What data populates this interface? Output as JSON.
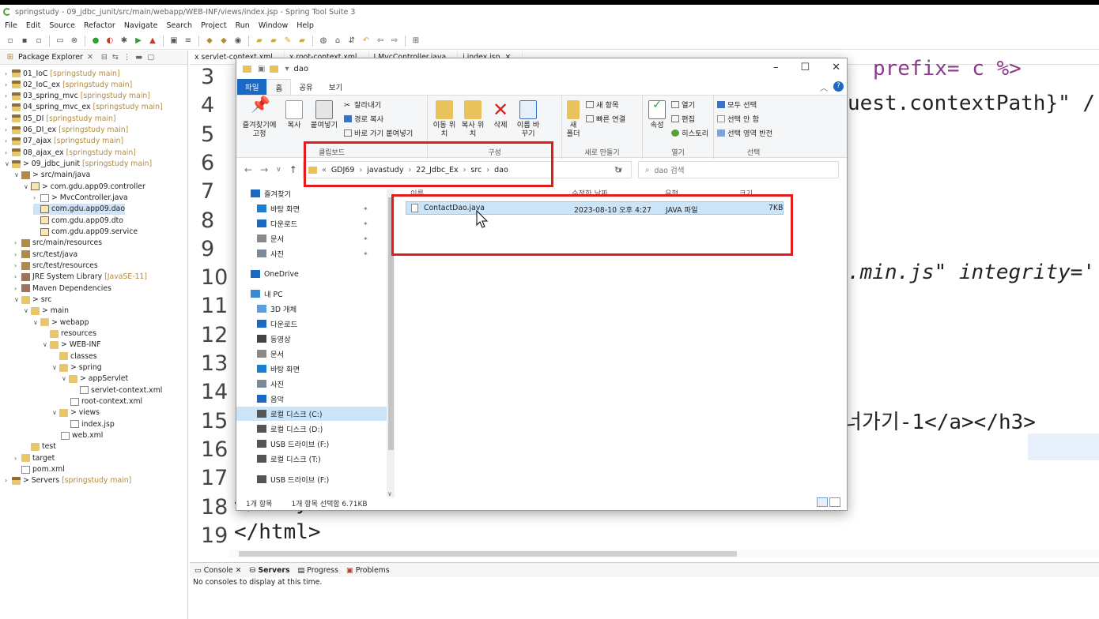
{
  "ide": {
    "title": "springstudy - 09_jdbc_junit/src/main/webapp/WEB-INF/views/index.jsp - Spring Tool Suite 3",
    "menu": [
      "File",
      "Edit",
      "Source",
      "Refactor",
      "Navigate",
      "Search",
      "Project",
      "Run",
      "Window",
      "Help"
    ]
  },
  "explorer": {
    "tab_label": "Package Explorer",
    "tree": [
      {
        "label": "01_IoC",
        "sub": "[springstudy main]",
        "icon": "project-icon",
        "arrow": ">"
      },
      {
        "label": "02_IoC_ex",
        "sub": "[springstudy main]",
        "icon": "project-icon",
        "arrow": ">"
      },
      {
        "label": "03_spring_mvc",
        "sub": "[springstudy main]",
        "icon": "project-icon",
        "arrow": ">"
      },
      {
        "label": "04_spring_mvc_ex",
        "sub": "[springstudy main]",
        "icon": "project-icon",
        "arrow": ">"
      },
      {
        "label": "05_DI",
        "sub": "[springstudy main]",
        "icon": "project-icon",
        "arrow": ">"
      },
      {
        "label": "06_DI_ex",
        "sub": "[springstudy main]",
        "icon": "project-icon",
        "arrow": ">"
      },
      {
        "label": "07_ajax",
        "sub": "[springstudy main]",
        "icon": "project-icon",
        "arrow": ">"
      },
      {
        "label": "08_ajax_ex",
        "sub": "[springstudy main]",
        "icon": "project-icon",
        "arrow": ">"
      },
      {
        "label": "> 09_jdbc_junit",
        "sub": "[springstudy main]",
        "icon": "project-icon",
        "arrow": "v"
      },
      {
        "label": "> src/main/java",
        "sub": "",
        "icon": "source-folder-icon",
        "arrow": "v"
      },
      {
        "label": "> com.gdu.app09.controller",
        "sub": "",
        "icon": "package-icon",
        "arrow": "v"
      },
      {
        "label": "> MvcController.java",
        "sub": "",
        "icon": "java-file-icon",
        "arrow": ">"
      },
      {
        "label": "com.gdu.app09.dao",
        "sub": "",
        "icon": "package-icon",
        "arrow": ""
      },
      {
        "label": "com.gdu.app09.dto",
        "sub": "",
        "icon": "package-icon",
        "arrow": ""
      },
      {
        "label": "com.gdu.app09.service",
        "sub": "",
        "icon": "package-icon",
        "arrow": ""
      },
      {
        "label": "src/main/resources",
        "sub": "",
        "icon": "source-folder-icon",
        "arrow": ">"
      },
      {
        "label": "src/test/java",
        "sub": "",
        "icon": "source-folder-icon",
        "arrow": ">"
      },
      {
        "label": "src/test/resources",
        "sub": "",
        "icon": "source-folder-icon",
        "arrow": ">"
      },
      {
        "label": "JRE System Library",
        "sub": "[JavaSE-11]",
        "icon": "library-icon",
        "arrow": ">"
      },
      {
        "label": "Maven Dependencies",
        "sub": "",
        "icon": "library-icon",
        "arrow": ">"
      },
      {
        "label": "> src",
        "sub": "",
        "icon": "folder-icon",
        "arrow": "v"
      },
      {
        "label": "> main",
        "sub": "",
        "icon": "folder-icon",
        "arrow": "v"
      },
      {
        "label": "> webapp",
        "sub": "",
        "icon": "folder-icon",
        "arrow": "v"
      },
      {
        "label": "resources",
        "sub": "",
        "icon": "folder-icon",
        "arrow": ""
      },
      {
        "label": "> WEB-INF",
        "sub": "",
        "icon": "folder-icon",
        "arrow": "v"
      },
      {
        "label": "classes",
        "sub": "",
        "icon": "folder-icon",
        "arrow": ""
      },
      {
        "label": "> spring",
        "sub": "",
        "icon": "folder-icon",
        "arrow": "v"
      },
      {
        "label": "> appServlet",
        "sub": "",
        "icon": "folder-icon",
        "arrow": "v"
      },
      {
        "label": "servlet-context.xml",
        "sub": "",
        "icon": "xml-file-icon",
        "arrow": ""
      },
      {
        "label": "root-context.xml",
        "sub": "",
        "icon": "xml-file-icon",
        "arrow": ""
      },
      {
        "label": "> views",
        "sub": "",
        "icon": "folder-icon",
        "arrow": "v"
      },
      {
        "label": "index.jsp",
        "sub": "",
        "icon": "jsp-file-icon",
        "arrow": ""
      },
      {
        "label": "web.xml",
        "sub": "",
        "icon": "xml-file-icon",
        "arrow": ""
      },
      {
        "label": "test",
        "sub": "",
        "icon": "folder-icon",
        "arrow": ""
      },
      {
        "label": "target",
        "sub": "",
        "icon": "folder-icon",
        "arrow": ">"
      },
      {
        "label": "pom.xml",
        "sub": "",
        "icon": "xml-file-icon",
        "arrow": ""
      },
      {
        "label": "> Servers",
        "sub": "[springstudy main]",
        "icon": "project-icon",
        "arrow": ">"
      }
    ]
  },
  "editor": {
    "tabs": [
      "servlet-context.xml",
      "root-context.xml",
      "MvcController.java",
      "index.jsp"
    ],
    "line_numbers": [
      "3",
      "4",
      "5",
      "6",
      "7",
      "8",
      "9",
      "10",
      "11",
      "12",
      "13",
      "14",
      "15",
      "16",
      "17",
      "18",
      "19"
    ],
    "code_fragments": {
      "l3": "prefix= c %>",
      "l4": "uest.contextPath}\" /",
      "l10": ".min.js\" integrity='",
      "l15": "너가기-1</a></h3>",
      "l18": "</body>",
      "l19": "</html>"
    }
  },
  "console": {
    "tabs": [
      "Console",
      "Servers",
      "Progress",
      "Problems"
    ],
    "message": "No consoles to display at this time."
  },
  "file_explorer": {
    "title": "dao",
    "ribbon_tabs": [
      "파일",
      "홈",
      "공유",
      "보기"
    ],
    "clipboard": {
      "pin_label": "즐겨찾기에 고정",
      "copy_label": "복사",
      "paste_label": "붙여넣기",
      "cut_label": "잘라내기",
      "copy_path_label": "경로 복사",
      "paste_shortcut_label": "바로 가기 붙여넣기",
      "group_label": "클립보드"
    },
    "organize": {
      "move_to_label": "이동 위치",
      "copy_to_label": "복사 위치",
      "delete_label": "삭제",
      "rename_label": "이름 바꾸기",
      "group_label": "구성"
    },
    "new": {
      "new_folder_label": "새 폴더",
      "new_item_label": "새 항목",
      "easy_access_label": "빠른 연결",
      "group_label": "새로 만들기"
    },
    "open": {
      "properties_label": "속성",
      "open_label": "열기",
      "edit_label": "편집",
      "history_label": "히스토리",
      "group_label": "열기"
    },
    "select": {
      "select_all_label": "모두 선택",
      "select_none_label": "선택 안 함",
      "invert_label": "선택 영역 반전",
      "group_label": "선택"
    },
    "address": {
      "prefix": "«",
      "path": [
        "GDJ69",
        "javastudy",
        "22_Jdbc_Ex",
        "src",
        "dao"
      ]
    },
    "search_placeholder": "dao 검색",
    "nav_pane": [
      {
        "label": "즐겨찾기",
        "icon": "star-icon",
        "pinned": false
      },
      {
        "label": "바탕 화면",
        "icon": "desktop-icon",
        "pinned": true
      },
      {
        "label": "다운로드",
        "icon": "download-icon",
        "pinned": true
      },
      {
        "label": "문서",
        "icon": "document-icon",
        "pinned": true
      },
      {
        "label": "사진",
        "icon": "pictures-icon",
        "pinned": true
      },
      {
        "label": "OneDrive",
        "icon": "cloud-icon",
        "pinned": false
      },
      {
        "label": "내 PC",
        "icon": "pc-icon",
        "pinned": false
      },
      {
        "label": "3D 개체",
        "icon": "cube-icon",
        "pinned": false
      },
      {
        "label": "다운로드",
        "icon": "download-icon",
        "pinned": false
      },
      {
        "label": "동영상",
        "icon": "video-icon",
        "pinned": false
      },
      {
        "label": "문서",
        "icon": "document-icon",
        "pinned": false
      },
      {
        "label": "바탕 화면",
        "icon": "desktop-icon",
        "pinned": false
      },
      {
        "label": "사진",
        "icon": "pictures-icon",
        "pinned": false
      },
      {
        "label": "음악",
        "icon": "music-icon",
        "pinned": false
      },
      {
        "label": "로컬 디스크 (C:)",
        "icon": "drive-icon",
        "pinned": false
      },
      {
        "label": "로컬 디스크 (D:)",
        "icon": "drive-icon",
        "pinned": false
      },
      {
        "label": "USB 드라이브 (F:)",
        "icon": "usb-drive-icon",
        "pinned": false
      },
      {
        "label": "로컬 디스크 (T:)",
        "icon": "drive-icon",
        "pinned": false
      },
      {
        "label": "USB 드라이브 (F:)",
        "icon": "usb-drive-icon",
        "pinned": false
      }
    ],
    "columns": [
      "이름",
      "수정한 날짜",
      "유형",
      "크기"
    ],
    "file": {
      "name": "ContactDao.java",
      "modified": "2023-08-10 오후 4:27",
      "type": "JAVA 파일",
      "size": "7KB"
    },
    "status": {
      "count": "1개 항목",
      "selected": "1개 항목 선택함 6.71KB"
    }
  },
  "colors": {
    "annotation_red": "#e31b1b",
    "ribbon_file_blue": "#1a69c4",
    "selection_blue": "#cce4f7",
    "jsp_tag_color": "#8b3a8b"
  }
}
